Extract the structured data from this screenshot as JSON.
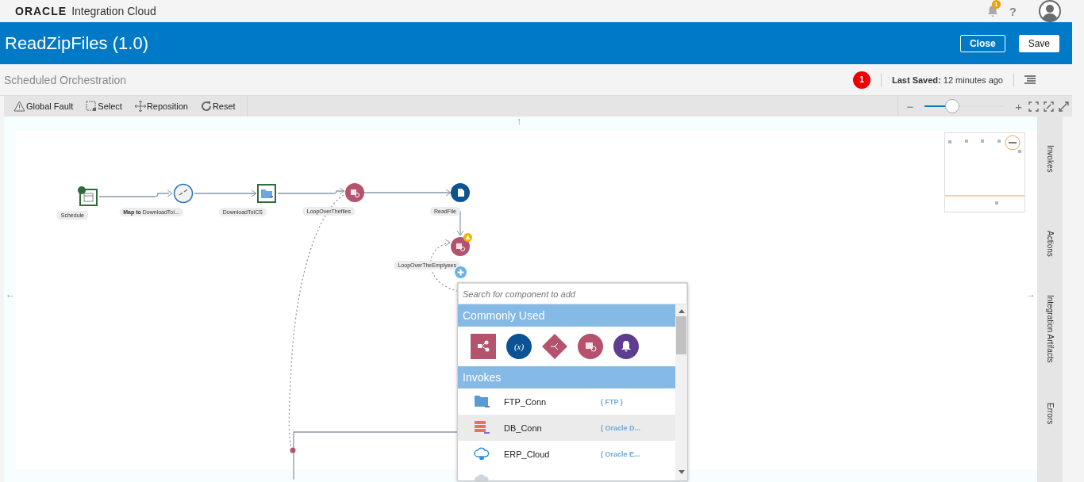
{
  "header": {
    "logo": "ORACLE",
    "product": "Integration Cloud",
    "notifications": "1",
    "help": "?"
  },
  "titlebar": {
    "title": "ReadZipFiles (1.0)",
    "buttons": [
      "Close",
      "Save"
    ]
  },
  "subbar": {
    "subtitle": "Scheduled Orchestration",
    "errors": "1",
    "last_saved": "**Last Saved:** 12 minutes ago"
  },
  "toolbar": {
    "tools": [
      {
        "kind": "fault",
        "label": "Global Fault"
      },
      {
        "kind": "select",
        "label": "Select"
      },
      {
        "kind": "move",
        "label": "Reposition"
      },
      {
        "kind": "reset",
        "label": "Reset"
      }
    ],
    "zoom": {
      "level": 0.35,
      "minus": "−",
      "plus": "+"
    }
  },
  "canvas": {
    "scroll_arrows": [
      "↑",
      "←",
      "→"
    ],
    "nodes": [
      {
        "kind": "schedule",
        "label": "Schedule",
        "warning": false
      },
      {
        "kind": "map",
        "label": "**Map to** DownloadToI...",
        "warning": false
      },
      {
        "kind": "invoke",
        "label": "DownloadToICS",
        "warning": false
      },
      {
        "kind": "for-each",
        "label": "LoopOverThefiles",
        "warning": false
      },
      {
        "kind": "stage-file",
        "label": "ReadFile",
        "warning": false
      },
      {
        "kind": "for-each",
        "label": "LoopOverTheEmplyees",
        "warning": true
      }
    ]
  },
  "palette": {
    "search": {
      "placeholder": "Search for component to add"
    },
    "sections": [
      {
        "title": "Commonly Used",
        "kind": "icons",
        "items": [
          {
            "kind": "map"
          },
          {
            "kind": "assign",
            "symbol": "(x)"
          },
          {
            "kind": "switch"
          },
          {
            "kind": "for-each"
          },
          {
            "kind": "notification"
          }
        ]
      },
      {
        "title": "Invokes",
        "kind": "list",
        "items": [
          {
            "kind": "ftp",
            "name": "FTP_Conn",
            "type": "( FTP )",
            "selected": false
          },
          {
            "kind": "db",
            "name": "DB_Conn",
            "type": "( Oracle D...",
            "selected": true
          },
          {
            "kind": "cloud",
            "name": "ERP_Cloud",
            "type": "( Oracle E...",
            "selected": false
          }
        ]
      }
    ]
  },
  "side_tabs": [
    "Invokes",
    "Actions",
    "Integration Artifacts",
    "Errors"
  ]
}
